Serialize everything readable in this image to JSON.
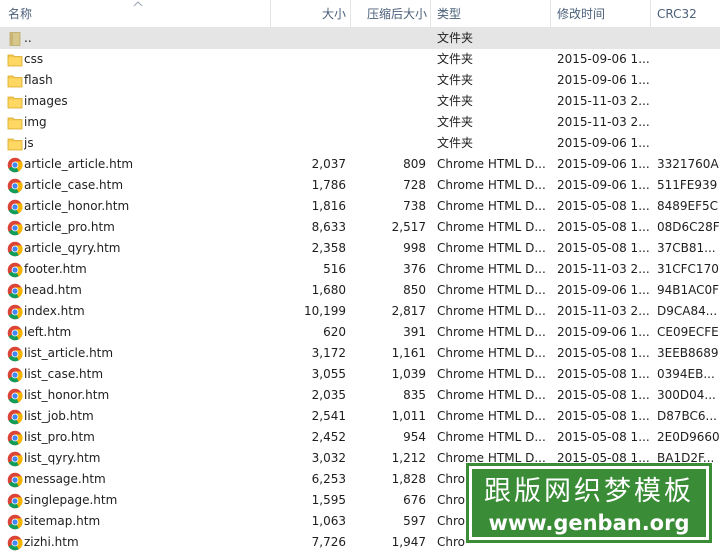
{
  "columns": {
    "name": "名称",
    "size": "大小",
    "packed": "压缩后大小",
    "type": "类型",
    "mtime": "修改时间",
    "crc": "CRC32"
  },
  "rows": [
    {
      "name": "..",
      "size": "",
      "packed": "",
      "type": "文件夹",
      "mtime": "",
      "crc": "",
      "icon": "parent-folder-icon"
    },
    {
      "name": "css",
      "size": "",
      "packed": "",
      "type": "文件夹",
      "mtime": "2015-09-06 1...",
      "crc": "",
      "icon": "folder-icon"
    },
    {
      "name": "flash",
      "size": "",
      "packed": "",
      "type": "文件夹",
      "mtime": "2015-09-06 1...",
      "crc": "",
      "icon": "folder-icon"
    },
    {
      "name": "images",
      "size": "",
      "packed": "",
      "type": "文件夹",
      "mtime": "2015-11-03 2...",
      "crc": "",
      "icon": "folder-icon"
    },
    {
      "name": "img",
      "size": "",
      "packed": "",
      "type": "文件夹",
      "mtime": "2015-11-03 2...",
      "crc": "",
      "icon": "folder-icon"
    },
    {
      "name": "js",
      "size": "",
      "packed": "",
      "type": "文件夹",
      "mtime": "2015-09-06 1...",
      "crc": "",
      "icon": "folder-icon"
    },
    {
      "name": "article_article.htm",
      "size": "2,037",
      "packed": "809",
      "type": "Chrome HTML D...",
      "mtime": "2015-09-06 1...",
      "crc": "3321760A",
      "icon": "chrome-icon"
    },
    {
      "name": "article_case.htm",
      "size": "1,786",
      "packed": "728",
      "type": "Chrome HTML D...",
      "mtime": "2015-09-06 1...",
      "crc": "511FE939",
      "icon": "chrome-icon"
    },
    {
      "name": "article_honor.htm",
      "size": "1,816",
      "packed": "738",
      "type": "Chrome HTML D...",
      "mtime": "2015-05-08 1...",
      "crc": "8489EF5C",
      "icon": "chrome-icon"
    },
    {
      "name": "article_pro.htm",
      "size": "8,633",
      "packed": "2,517",
      "type": "Chrome HTML D...",
      "mtime": "2015-05-08 1...",
      "crc": "08D6C28F",
      "icon": "chrome-icon"
    },
    {
      "name": "article_qyry.htm",
      "size": "2,358",
      "packed": "998",
      "type": "Chrome HTML D...",
      "mtime": "2015-05-08 1...",
      "crc": "37CB81...",
      "icon": "chrome-icon"
    },
    {
      "name": "footer.htm",
      "size": "516",
      "packed": "376",
      "type": "Chrome HTML D...",
      "mtime": "2015-11-03 2...",
      "crc": "31CFC170",
      "icon": "chrome-icon"
    },
    {
      "name": "head.htm",
      "size": "1,680",
      "packed": "850",
      "type": "Chrome HTML D...",
      "mtime": "2015-09-06 1...",
      "crc": "94B1AC0F",
      "icon": "chrome-icon"
    },
    {
      "name": "index.htm",
      "size": "10,199",
      "packed": "2,817",
      "type": "Chrome HTML D...",
      "mtime": "2015-11-03 2...",
      "crc": "D9CA84...",
      "icon": "chrome-icon"
    },
    {
      "name": "left.htm",
      "size": "620",
      "packed": "391",
      "type": "Chrome HTML D...",
      "mtime": "2015-09-06 1...",
      "crc": "CE09ECFE",
      "icon": "chrome-icon"
    },
    {
      "name": "list_article.htm",
      "size": "3,172",
      "packed": "1,161",
      "type": "Chrome HTML D...",
      "mtime": "2015-05-08 1...",
      "crc": "3EEB8689",
      "icon": "chrome-icon"
    },
    {
      "name": "list_case.htm",
      "size": "3,055",
      "packed": "1,039",
      "type": "Chrome HTML D...",
      "mtime": "2015-05-08 1...",
      "crc": "0394EB...",
      "icon": "chrome-icon"
    },
    {
      "name": "list_honor.htm",
      "size": "2,035",
      "packed": "835",
      "type": "Chrome HTML D...",
      "mtime": "2015-05-08 1...",
      "crc": "300D04...",
      "icon": "chrome-icon"
    },
    {
      "name": "list_job.htm",
      "size": "2,541",
      "packed": "1,011",
      "type": "Chrome HTML D...",
      "mtime": "2015-05-08 1...",
      "crc": "D87BC6...",
      "icon": "chrome-icon"
    },
    {
      "name": "list_pro.htm",
      "size": "2,452",
      "packed": "954",
      "type": "Chrome HTML D...",
      "mtime": "2015-05-08 1...",
      "crc": "2E0D9660",
      "icon": "chrome-icon"
    },
    {
      "name": "list_qyry.htm",
      "size": "3,032",
      "packed": "1,212",
      "type": "Chrome HTML D...",
      "mtime": "2015-05-08 1...",
      "crc": "BA1D2F...",
      "icon": "chrome-icon"
    },
    {
      "name": "message.htm",
      "size": "6,253",
      "packed": "1,828",
      "type": "Chro",
      "mtime": "",
      "crc": "",
      "icon": "chrome-icon"
    },
    {
      "name": "singlepage.htm",
      "size": "1,595",
      "packed": "676",
      "type": "Chro",
      "mtime": "",
      "crc": "",
      "icon": "chrome-icon"
    },
    {
      "name": "sitemap.htm",
      "size": "1,063",
      "packed": "597",
      "type": "Chro",
      "mtime": "",
      "crc": "",
      "icon": "chrome-icon"
    },
    {
      "name": "zizhi.htm",
      "size": "7,726",
      "packed": "1,947",
      "type": "Chro",
      "mtime": "",
      "crc": "",
      "icon": "chrome-icon"
    }
  ],
  "watermark": {
    "line1": "跟版网织梦模板",
    "line2": "www.genban.org"
  },
  "colors": {
    "header_text": "#4c607a",
    "selection": "#e5e5e5",
    "watermark_green": "#3a8c36",
    "folder": "#f4c94e"
  }
}
